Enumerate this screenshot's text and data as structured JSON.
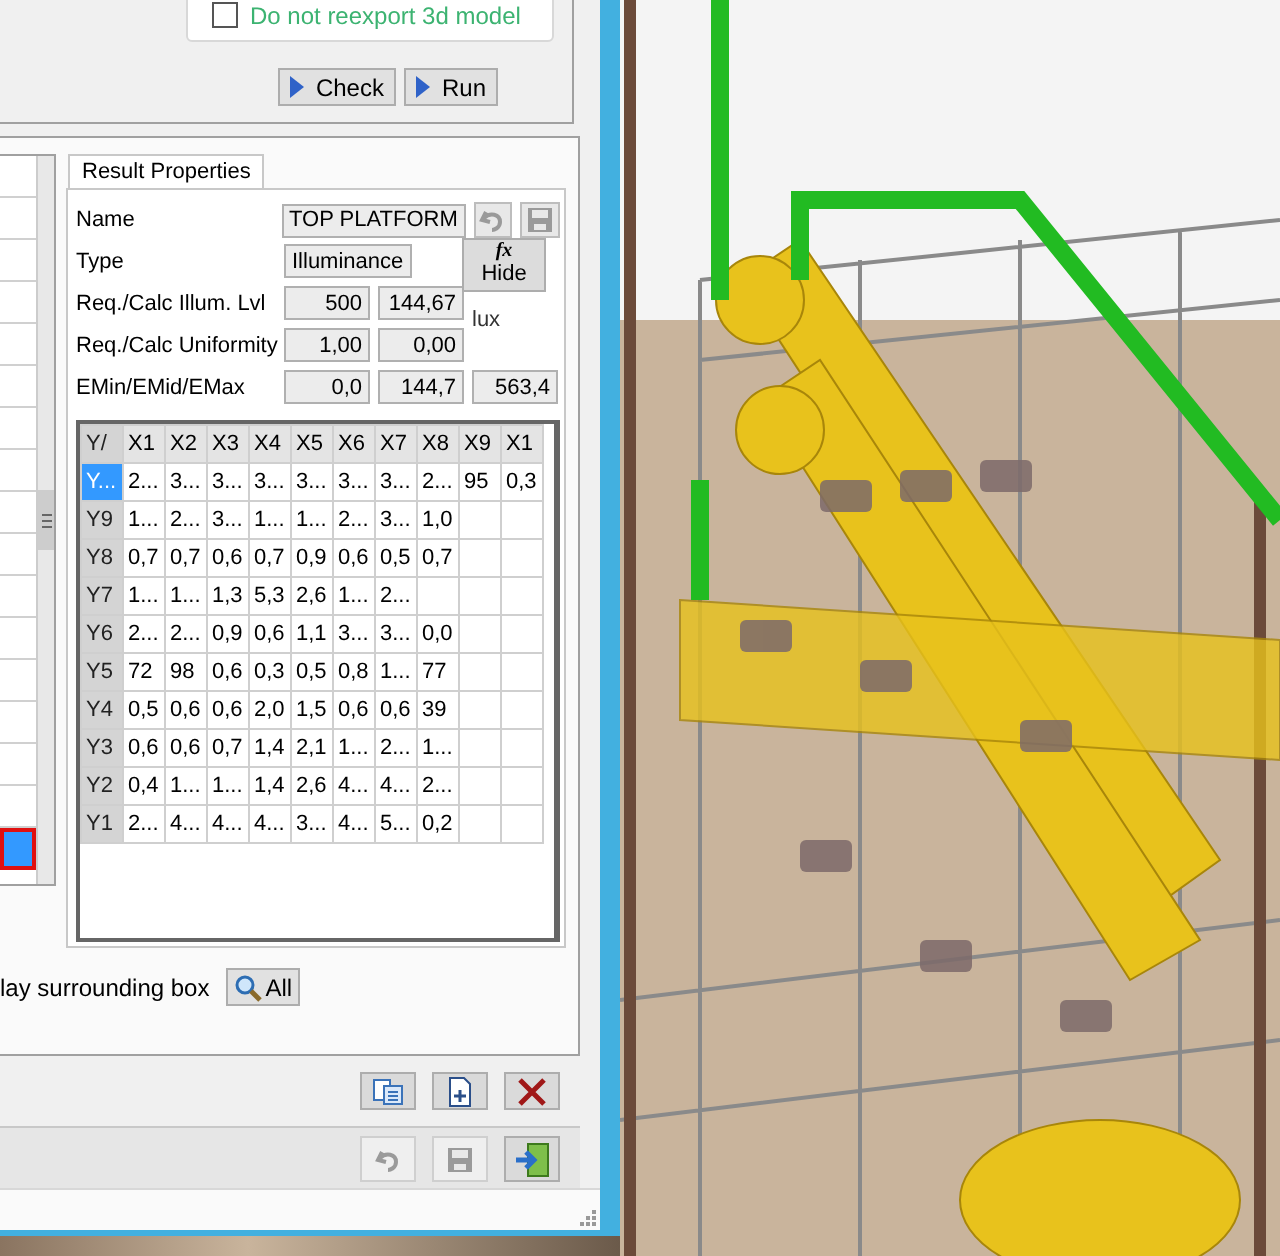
{
  "options": {
    "checkbox": {
      "label": "Do not reexport 3d model",
      "checked": false
    },
    "buttons": [
      {
        "label": "Check"
      },
      {
        "label": "Run"
      }
    ]
  },
  "left_list": {
    "rows": [
      {
        "selected": false
      },
      {
        "selected": false
      },
      {
        "selected": false
      },
      {
        "selected": false
      },
      {
        "selected": false
      },
      {
        "selected": false
      },
      {
        "selected": false
      },
      {
        "selected": false
      },
      {
        "selected": false
      },
      {
        "selected": false
      },
      {
        "selected": false
      },
      {
        "selected": false
      },
      {
        "selected": false
      },
      {
        "selected": false
      },
      {
        "selected": false
      },
      {
        "selected": false
      },
      {
        "selected": true
      }
    ]
  },
  "result_properties": {
    "tab": "Result Properties",
    "name_label": "Name",
    "name_value": "TOP PLATFORM",
    "name_actions": [
      {
        "kind": "undo",
        "disabled": true
      },
      {
        "kind": "save",
        "disabled": true
      }
    ],
    "type_label": "Type",
    "type_value": "Illuminance",
    "hide_button": {
      "icon": "fx",
      "label": "Hide"
    },
    "rows": [
      {
        "label": "Req./Calc Illum. Lvl",
        "values": [
          "500",
          "144,67"
        ],
        "unit": "lux"
      },
      {
        "label": "Req./Calc Uniformity",
        "values": [
          "1,00",
          "0,00"
        ]
      },
      {
        "label": "EMin/EMid/EMax",
        "values": [
          "0,0",
          "144,7",
          "563,4"
        ]
      }
    ],
    "grid": {
      "corner": "Y/",
      "columns": [
        "X1",
        "X2",
        "X3",
        "X4",
        "X5",
        "X6",
        "X7",
        "X8",
        "X9",
        "X1"
      ],
      "rows": [
        {
          "header": "Y...",
          "selected": true,
          "cells": [
            "2...",
            "3...",
            "3...",
            "3...",
            "3...",
            "3...",
            "3...",
            "2...",
            "95",
            "0,3"
          ]
        },
        {
          "header": "Y9",
          "selected": false,
          "cells": [
            "1...",
            "2...",
            "3...",
            "1...",
            "1...",
            "2...",
            "3...",
            "1,0",
            "",
            ""
          ]
        },
        {
          "header": "Y8",
          "selected": false,
          "cells": [
            "0,7",
            "0,7",
            "0,6",
            "0,7",
            "0,9",
            "0,6",
            "0,5",
            "0,7",
            "",
            ""
          ]
        },
        {
          "header": "Y7",
          "selected": false,
          "cells": [
            "1...",
            "1...",
            "1,3",
            "5,3",
            "2,6",
            "1...",
            "2...",
            "",
            "",
            ""
          ]
        },
        {
          "header": "Y6",
          "selected": false,
          "cells": [
            "2...",
            "2...",
            "0,9",
            "0,6",
            "1,1",
            "3...",
            "3...",
            "0,0",
            "",
            ""
          ]
        },
        {
          "header": "Y5",
          "selected": false,
          "cells": [
            "72",
            "98",
            "0,6",
            "0,3",
            "0,5",
            "0,8",
            "1...",
            "77",
            "",
            ""
          ]
        },
        {
          "header": "Y4",
          "selected": false,
          "cells": [
            "0,5",
            "0,6",
            "0,6",
            "2,0",
            "1,5",
            "0,6",
            "0,6",
            "39",
            "",
            ""
          ]
        },
        {
          "header": "Y3",
          "selected": false,
          "cells": [
            "0,6",
            "0,6",
            "0,7",
            "1,4",
            "2,1",
            "1...",
            "2...",
            "1...",
            "",
            ""
          ]
        },
        {
          "header": "Y2",
          "selected": false,
          "cells": [
            "0,4",
            "1...",
            "1...",
            "1,4",
            "2,6",
            "4...",
            "4...",
            "2...",
            "",
            ""
          ]
        },
        {
          "header": "Y1",
          "selected": false,
          "cells": [
            "2...",
            "4...",
            "4...",
            "4...",
            "3...",
            "4...",
            "5...",
            "0,2",
            "",
            ""
          ]
        }
      ]
    }
  },
  "surrounding": {
    "label": "lay surrounding box",
    "button": "All"
  },
  "toolbar": [
    {
      "kind": "copy",
      "disabled": false
    },
    {
      "kind": "add",
      "disabled": false
    },
    {
      "kind": "delete",
      "disabled": false
    }
  ],
  "footer": [
    {
      "kind": "undo",
      "disabled": true
    },
    {
      "kind": "save",
      "disabled": true
    },
    {
      "kind": "exit",
      "disabled": false
    }
  ]
}
